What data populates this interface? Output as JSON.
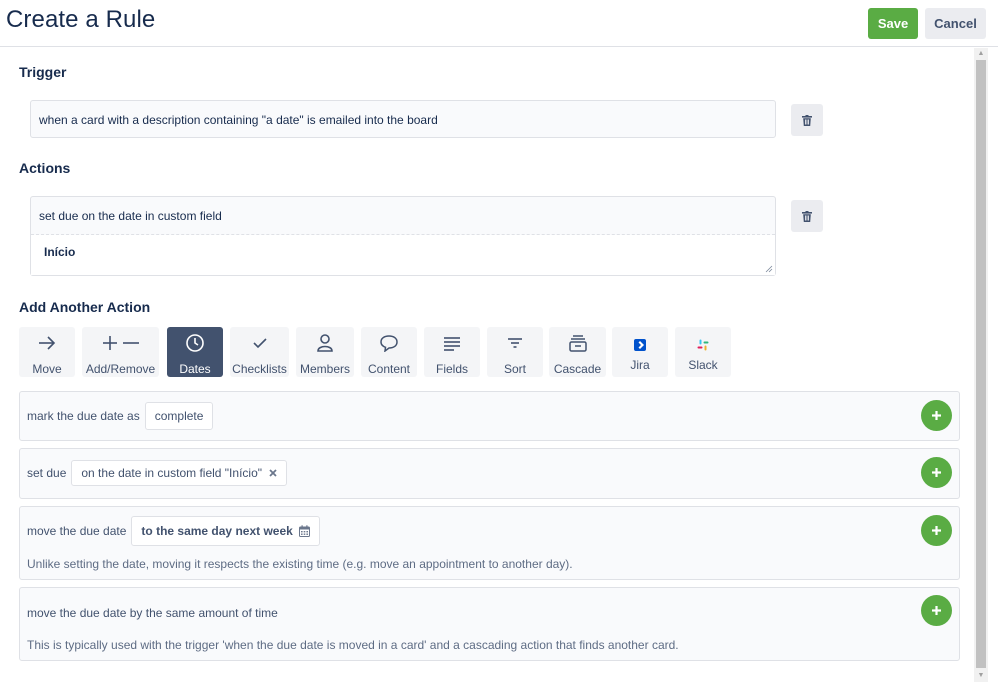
{
  "header": {
    "title": "Create a Rule",
    "save_label": "Save",
    "cancel_label": "Cancel"
  },
  "trigger": {
    "section_label": "Trigger",
    "text": "when a card with a description containing \"a date\" is emailed into the board"
  },
  "actions": {
    "section_label": "Actions",
    "text": "set due on the date in custom field",
    "field_value": "Início"
  },
  "add_action": {
    "section_label": "Add Another Action",
    "tabs": [
      {
        "label": "Move",
        "icon": "arrow-right-icon"
      },
      {
        "label": "Add/Remove",
        "icon": "plus-minus-icon"
      },
      {
        "label": "Dates",
        "icon": "clock-icon",
        "active": true
      },
      {
        "label": "Checklists",
        "icon": "check-icon"
      },
      {
        "label": "Members",
        "icon": "person-icon"
      },
      {
        "label": "Content",
        "icon": "speech-bubble-icon"
      },
      {
        "label": "Fields",
        "icon": "lines-icon"
      },
      {
        "label": "Sort",
        "icon": "filter-icon"
      },
      {
        "label": "Cascade",
        "icon": "stack-icon"
      },
      {
        "label": "Jira",
        "icon": "jira-icon"
      },
      {
        "label": "Slack",
        "icon": "slack-icon"
      }
    ]
  },
  "options": [
    {
      "prefix": "mark the due date as",
      "pill": "complete"
    },
    {
      "prefix": "set due",
      "pill": "on the date in custom field \"Início\""
    },
    {
      "prefix": "move the due date",
      "pill": "to the same day next week",
      "note": "Unlike setting the date, moving it respects the existing time (e.g. move an appointment to another day)."
    },
    {
      "prefix": "move the due date by the same amount of time",
      "note": "This is typically used with the trigger 'when the due date is moved in a card' and a cascading action that finds another card."
    }
  ],
  "colors": {
    "accent_green": "#5aac44",
    "active_tab": "#42526e",
    "text": "#172b4d"
  }
}
